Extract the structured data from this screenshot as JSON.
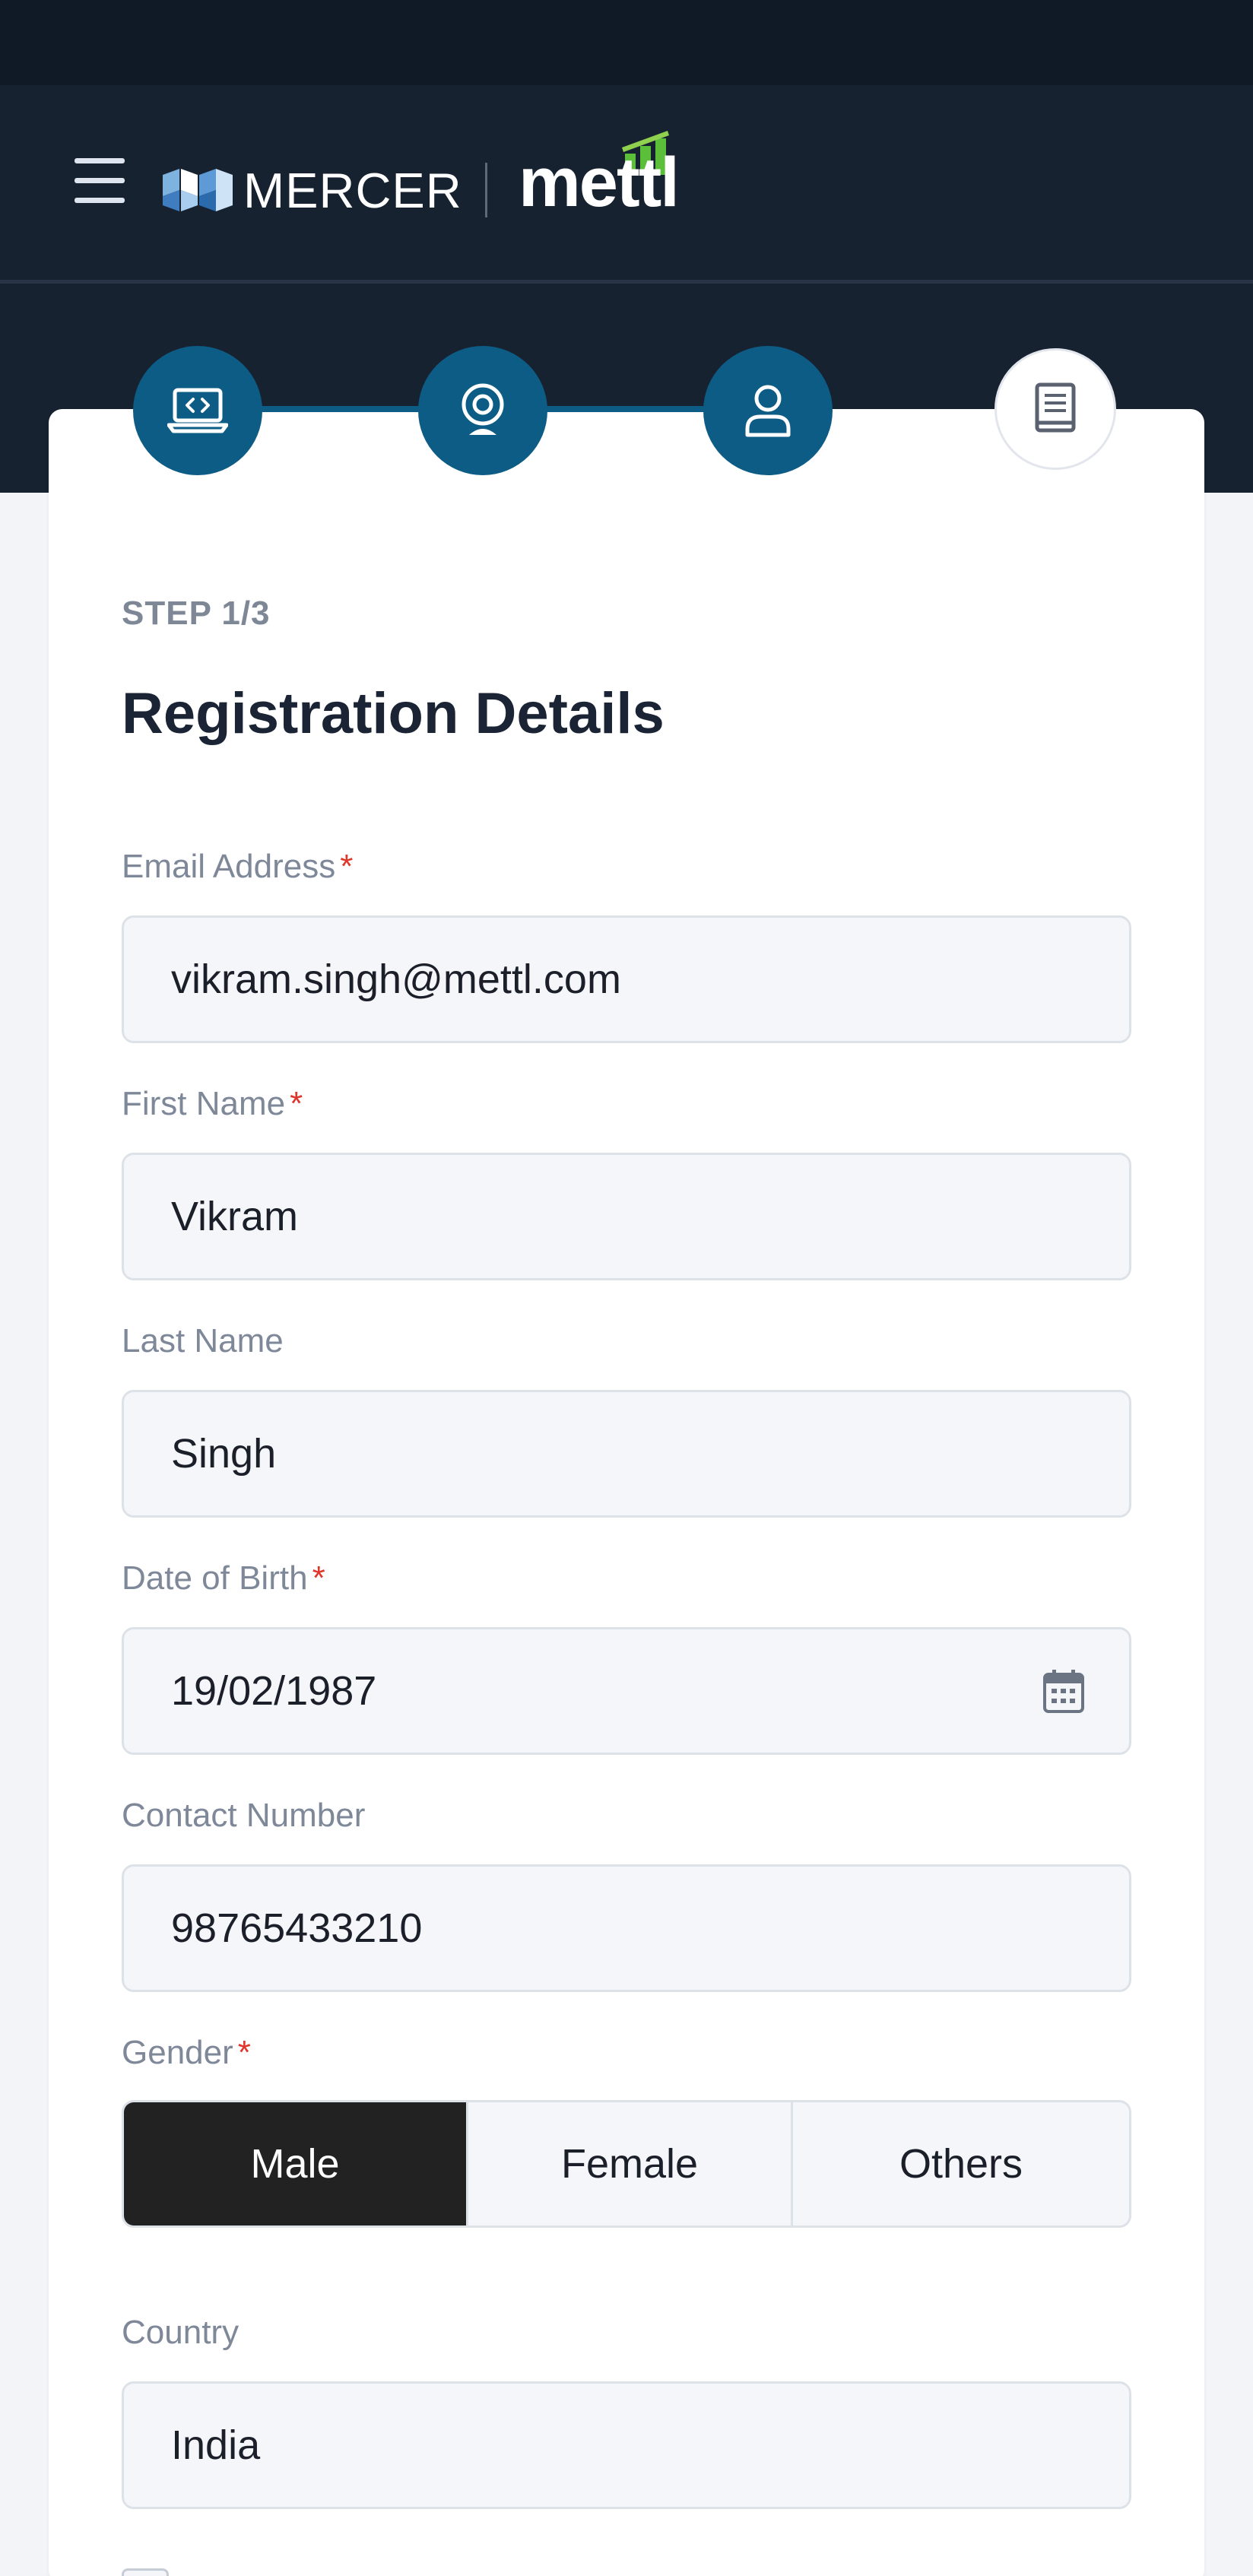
{
  "header": {
    "brand_mercer": "MERCER",
    "brand_mettl": "mettl"
  },
  "stepper": {
    "steps": [
      {
        "icon": "laptop-code-icon",
        "state": "completed"
      },
      {
        "icon": "webcam-icon",
        "state": "completed"
      },
      {
        "icon": "user-icon",
        "state": "completed"
      },
      {
        "icon": "book-icon",
        "state": "pending"
      }
    ]
  },
  "form": {
    "step_label": "STEP 1/3",
    "title": "Registration Details",
    "email": {
      "label": "Email Address",
      "required": true,
      "value": "vikram.singh@mettl.com"
    },
    "first_name": {
      "label": "First Name",
      "required": true,
      "value": "Vikram"
    },
    "last_name": {
      "label": "Last Name",
      "required": false,
      "value": "Singh"
    },
    "dob": {
      "label": "Date of Birth",
      "required": true,
      "value": "19/02/1987"
    },
    "contact": {
      "label": "Contact Number",
      "required": false,
      "value": "98765433210"
    },
    "gender": {
      "label": "Gender",
      "required": true,
      "options": [
        "Male",
        "Female",
        "Others"
      ],
      "selected": "Male"
    },
    "country": {
      "label": "Country",
      "required": false,
      "value": "India"
    }
  },
  "colors": {
    "header_bg": "#172231",
    "step_active": "#0d5c86",
    "required_marker": "#e0352b",
    "selected_option": "#222222"
  }
}
